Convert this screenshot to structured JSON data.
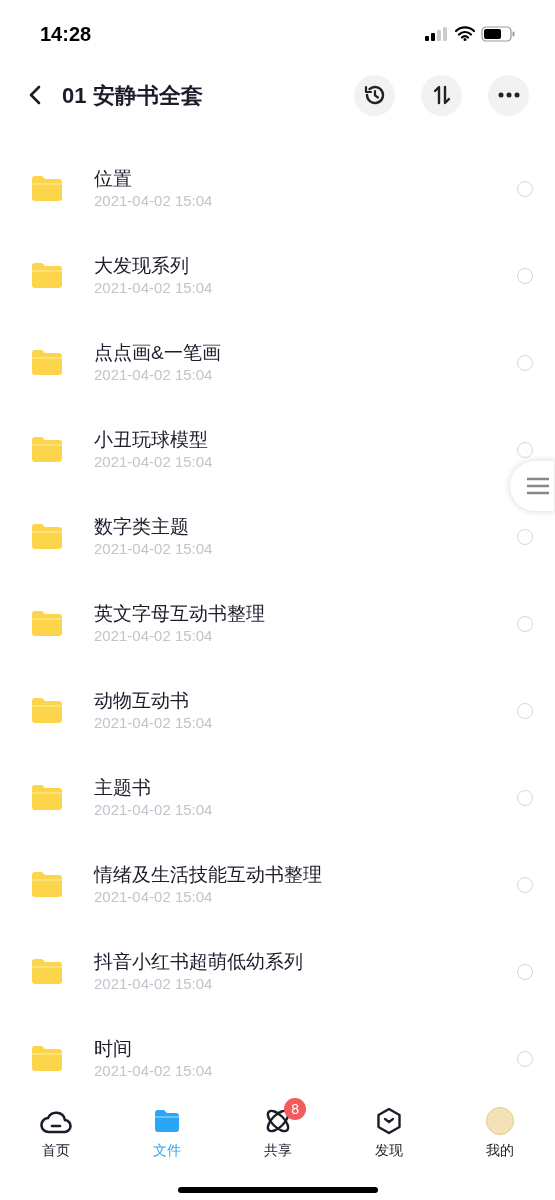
{
  "status_bar": {
    "time": "14:28"
  },
  "header": {
    "title": "01 安静书全套"
  },
  "folders": [
    {
      "name": "位置",
      "date": "2021-04-02 15:04",
      "checked": false
    },
    {
      "name": "大发现系列",
      "date": "2021-04-02 15:04",
      "checked": false
    },
    {
      "name": "点点画&一笔画",
      "date": "2021-04-02 15:04",
      "checked": false
    },
    {
      "name": "小丑玩球模型",
      "date": "2021-04-02 15:04",
      "checked": false
    },
    {
      "name": "数字类主题",
      "date": "2021-04-02 15:04",
      "checked": false
    },
    {
      "name": "英文字母互动书整理",
      "date": "2021-04-02 15:04",
      "checked": false
    },
    {
      "name": "动物互动书",
      "date": "2021-04-02 15:04",
      "checked": false
    },
    {
      "name": "主题书",
      "date": "2021-04-02 15:04",
      "checked": false
    },
    {
      "name": "情绪及生活技能互动书整理",
      "date": "2021-04-02 15:04",
      "checked": false
    },
    {
      "name": "抖音小红书超萌低幼系列",
      "date": "2021-04-02 15:04",
      "checked": false
    },
    {
      "name": "时间",
      "date": "2021-04-02 15:04",
      "checked": false
    }
  ],
  "tab_bar": [
    {
      "kind": "home",
      "label": "首页",
      "selected": false
    },
    {
      "kind": "files",
      "label": "文件",
      "selected": true
    },
    {
      "kind": "share",
      "label": "共享",
      "selected": false,
      "badge": "8"
    },
    {
      "kind": "discover",
      "label": "发现",
      "selected": false
    },
    {
      "kind": "profile",
      "label": "我的",
      "selected": false
    }
  ]
}
